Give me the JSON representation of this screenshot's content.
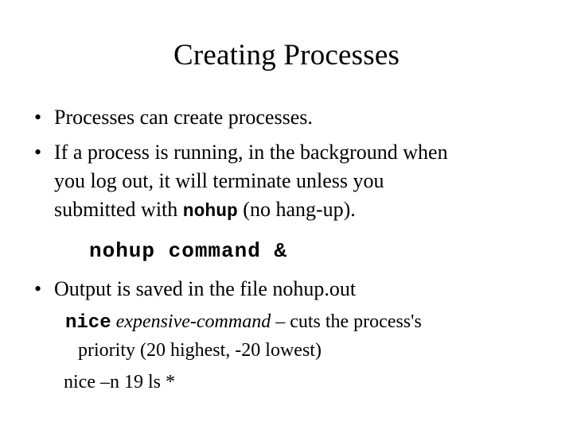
{
  "slide": {
    "title": "Creating Processes",
    "bullet_marker": "•",
    "bullets": [
      {
        "id": "processes-create",
        "text": "Processes can create processes."
      },
      {
        "id": "background-nohup",
        "line1": "If a process is running, in the background when",
        "line2": "you log out, it will terminate unless you",
        "line3_prefix": "submitted with ",
        "line3_mono": "nohup",
        "line3_suffix": " (no hang-up)."
      },
      {
        "id": "output-saved",
        "text": "Output is saved in the file nohup.out"
      }
    ],
    "command_example": "nohup command &",
    "nice_block": {
      "mono": "nice",
      "italic": "expensive-command",
      "tail": " – cuts the process's",
      "priority_line": "priority (20 highest, -20 lowest)",
      "example_line": "nice –n 19 ls *"
    }
  },
  "colors": {
    "background": "#ffffff",
    "text": "#000000"
  }
}
